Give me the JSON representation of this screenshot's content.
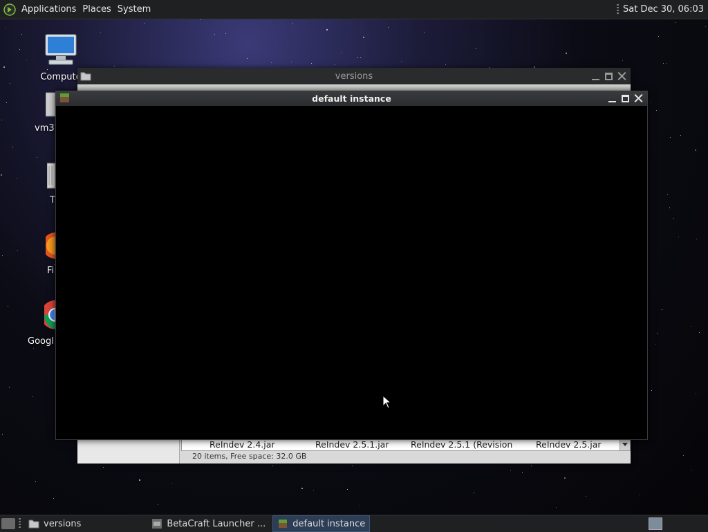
{
  "top_panel": {
    "menus": [
      "Applications",
      "Places",
      "System"
    ],
    "clock": "Sat Dec 30, 06:03"
  },
  "desktop_icons": [
    {
      "label": "Compute",
      "icon": "computer-icon"
    },
    {
      "label": "vm3'",
      "icon": "drive-icon"
    },
    {
      "label": "T",
      "icon": "trash-icon"
    },
    {
      "label": "Fi",
      "icon": "firefox-icon"
    },
    {
      "label": "Googl",
      "icon": "chrome-icon"
    }
  ],
  "versions_window": {
    "title": "versions",
    "files": [
      "ReIndev 2.4.jar",
      "ReIndev 2.5.1.jar",
      "ReIndev 2.5.1 (Revision",
      "ReIndev 2.5.jar"
    ],
    "status": "20 items, Free space: 32.0 GB"
  },
  "default_window": {
    "title": "default instance"
  },
  "taskbar": {
    "tasks": [
      {
        "label": "versions",
        "icon": "folder-icon"
      },
      {
        "label": "BetaCraft Launcher ...",
        "icon": "betacraft-icon"
      },
      {
        "label": "default instance",
        "icon": "minecraft-icon"
      }
    ]
  },
  "colors": {
    "panel": "#1f2022",
    "active_task": "#2c3d55"
  }
}
